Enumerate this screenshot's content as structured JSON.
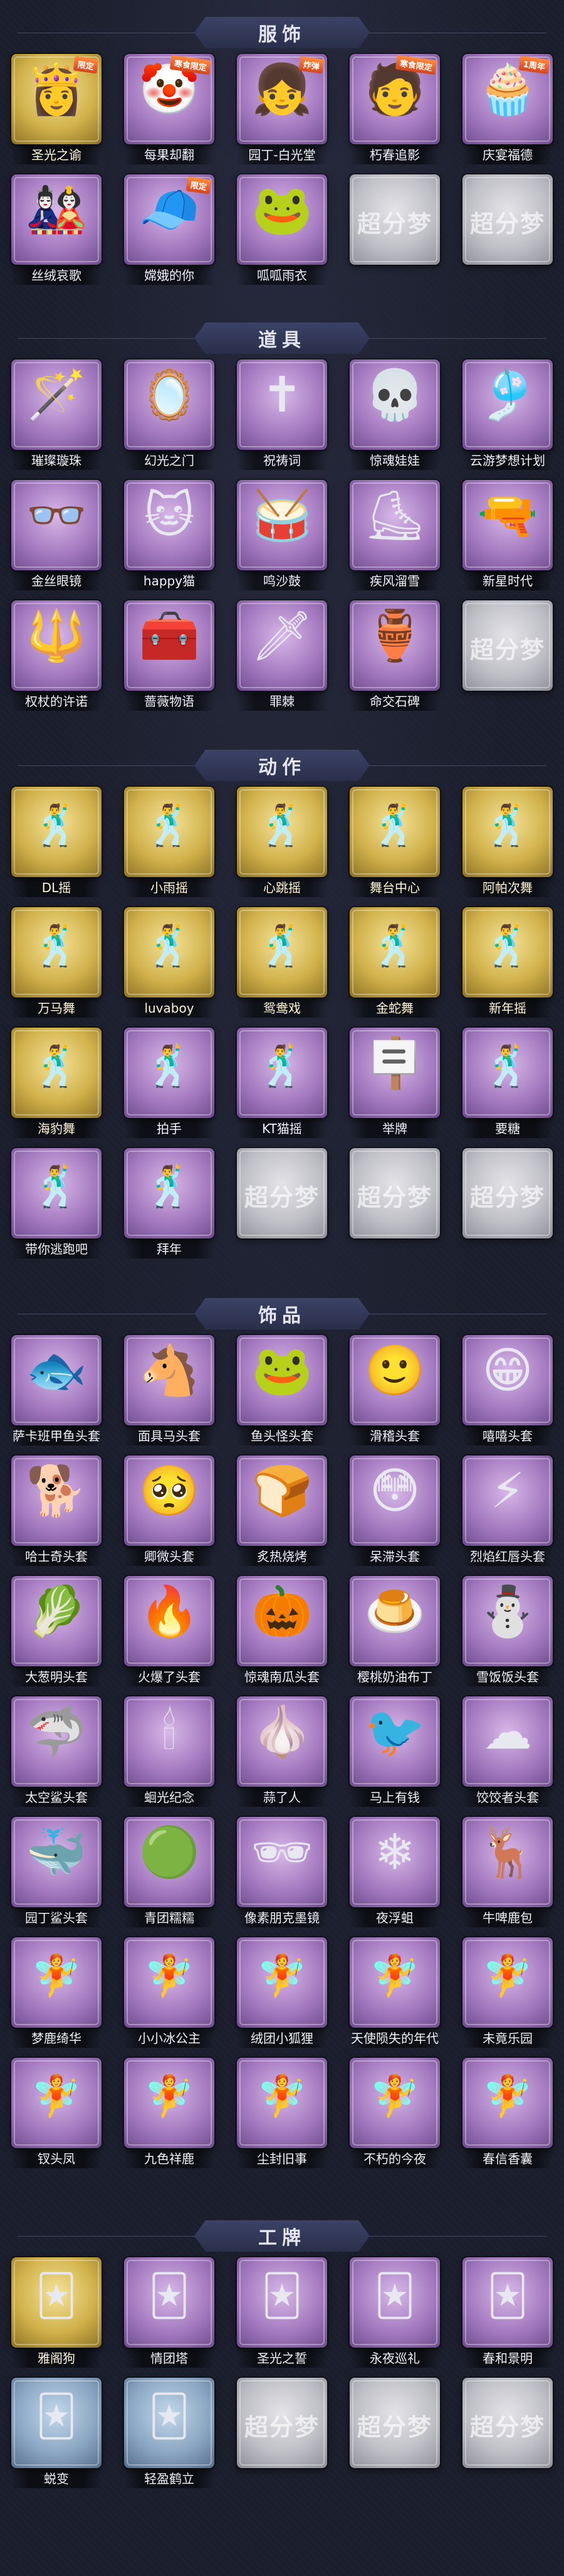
{
  "sections": [
    {
      "title": "服饰",
      "items": [
        {
          "label": "圣光之谕",
          "tier": "gold",
          "icon": "princess",
          "badge": "限定"
        },
        {
          "label": "每果却翻",
          "tier": "purple",
          "icon": "clown",
          "badge": "寒食限定"
        },
        {
          "label": "园丁-白光堂",
          "tier": "purple",
          "icon": "gardener",
          "badge": "炸弹"
        },
        {
          "label": "朽春追影",
          "tier": "purple",
          "icon": "boy",
          "badge": "寒食限定"
        },
        {
          "label": "庆宴福德",
          "tier": "purple",
          "icon": "chef",
          "badge": "1周年"
        },
        {
          "label": "丝绒哀歌",
          "tier": "purple",
          "icon": "doll"
        },
        {
          "label": "嫦娥的你",
          "tier": "purple",
          "icon": "girl-hat",
          "badge": "限定"
        },
        {
          "label": "呱呱雨衣",
          "tier": "purple",
          "icon": "frog-girl"
        },
        {
          "label": "",
          "tier": "grey",
          "placeholder": "超分梦"
        },
        {
          "label": "",
          "tier": "grey",
          "placeholder": "超分梦"
        }
      ]
    },
    {
      "title": "道具",
      "items": [
        {
          "label": "璀璨璇珠",
          "tier": "purple",
          "icon": "wand"
        },
        {
          "label": "幻光之门",
          "tier": "purple",
          "icon": "mirror"
        },
        {
          "label": "祝祷词",
          "tier": "purple",
          "icon": "cross"
        },
        {
          "label": "惊魂娃娃",
          "tier": "purple",
          "icon": "skull"
        },
        {
          "label": "云游梦想计划",
          "tier": "purple",
          "icon": "staff"
        },
        {
          "label": "金丝眼镜",
          "tier": "purple",
          "icon": "glasses"
        },
        {
          "label": "happy猫",
          "tier": "purple",
          "icon": "cat"
        },
        {
          "label": "鸣沙鼓",
          "tier": "purple",
          "icon": "drum"
        },
        {
          "label": "疾风溜雪",
          "tier": "purple",
          "icon": "skates"
        },
        {
          "label": "新星时代",
          "tier": "purple",
          "icon": "gun"
        },
        {
          "label": "权杖的许诺",
          "tier": "purple",
          "icon": "scepter"
        },
        {
          "label": "蔷薇物语",
          "tier": "purple",
          "icon": "firstaid"
        },
        {
          "label": "罪棘",
          "tier": "purple",
          "icon": "sword"
        },
        {
          "label": "命交石碑",
          "tier": "purple",
          "icon": "jar"
        },
        {
          "label": "",
          "tier": "grey",
          "placeholder": "超分梦"
        }
      ]
    },
    {
      "title": "动作",
      "items": [
        {
          "label": "DL摇",
          "tier": "gold",
          "icon": "pose"
        },
        {
          "label": "小雨摇",
          "tier": "gold",
          "icon": "pose"
        },
        {
          "label": "心跳摇",
          "tier": "gold",
          "icon": "pose"
        },
        {
          "label": "舞台中心",
          "tier": "gold",
          "icon": "pose"
        },
        {
          "label": "阿帕次舞",
          "tier": "gold",
          "icon": "pose"
        },
        {
          "label": "万马舞",
          "tier": "gold",
          "icon": "pose"
        },
        {
          "label": "luvaboy",
          "tier": "gold",
          "icon": "pose"
        },
        {
          "label": "鸳鸯戏",
          "tier": "gold",
          "icon": "pose"
        },
        {
          "label": "金蛇舞",
          "tier": "gold",
          "icon": "pose"
        },
        {
          "label": "新年摇",
          "tier": "gold",
          "icon": "pose"
        },
        {
          "label": "海豹舞",
          "tier": "gold",
          "icon": "pose"
        },
        {
          "label": "拍手",
          "tier": "purple",
          "icon": "pose"
        },
        {
          "label": "KT猫摇",
          "tier": "purple",
          "icon": "pose"
        },
        {
          "label": "举牌",
          "tier": "purple",
          "icon": "sign"
        },
        {
          "label": "要糖",
          "tier": "purple",
          "icon": "pose"
        },
        {
          "label": "带你逃跑吧",
          "tier": "purple",
          "icon": "pose"
        },
        {
          "label": "拜年",
          "tier": "purple",
          "icon": "pose"
        },
        {
          "label": "",
          "tier": "grey",
          "placeholder": "超分梦"
        },
        {
          "label": "",
          "tier": "grey",
          "placeholder": "超分梦"
        },
        {
          "label": "",
          "tier": "grey",
          "placeholder": "超分梦"
        }
      ]
    },
    {
      "title": "饰品",
      "items": [
        {
          "label": "萨卡班甲鱼头套",
          "tier": "purple",
          "icon": "fish"
        },
        {
          "label": "面具马头套",
          "tier": "purple",
          "icon": "horse"
        },
        {
          "label": "鱼头怪头套",
          "tier": "purple",
          "icon": "fishman"
        },
        {
          "label": "滑稽头套",
          "tier": "purple",
          "icon": "smile"
        },
        {
          "label": "嘻嘻头套",
          "tier": "purple",
          "icon": "grin"
        },
        {
          "label": "哈士奇头套",
          "tier": "purple",
          "icon": "dog"
        },
        {
          "label": "卿微头套",
          "tier": "purple",
          "icon": "pout"
        },
        {
          "label": "炙热烧烤",
          "tier": "purple",
          "icon": "toast"
        },
        {
          "label": "呆滞头套",
          "tier": "purple",
          "icon": "stare"
        },
        {
          "label": "烈焰红唇头套",
          "tier": "purple",
          "icon": "pikachu"
        },
        {
          "label": "大葱明头套",
          "tier": "purple",
          "icon": "bokchoy"
        },
        {
          "label": "火爆了头套",
          "tier": "purple",
          "icon": "fire"
        },
        {
          "label": "惊魂南瓜头套",
          "tier": "purple",
          "icon": "pumpkin"
        },
        {
          "label": "樱桃奶油布丁",
          "tier": "purple",
          "icon": "pudding"
        },
        {
          "label": "雪饭饭头套",
          "tier": "purple",
          "icon": "snowman"
        },
        {
          "label": "太空鲨头套",
          "tier": "purple",
          "icon": "shark"
        },
        {
          "label": "蛔光纪念",
          "tier": "purple",
          "icon": "candle"
        },
        {
          "label": "蒜了人",
          "tier": "purple",
          "icon": "garlic"
        },
        {
          "label": "马上有钱",
          "tier": "purple",
          "icon": "bird"
        },
        {
          "label": "饺饺者头套",
          "tier": "purple",
          "icon": "cloud"
        },
        {
          "label": "园丁鲨头套",
          "tier": "purple",
          "icon": "bluecat"
        },
        {
          "label": "青团糯糯",
          "tier": "purple",
          "icon": "greenbun"
        },
        {
          "label": "像素朋克墨镜",
          "tier": "purple",
          "icon": "sunglasses"
        },
        {
          "label": "夜浮蛆",
          "tier": "purple",
          "icon": "crystal"
        },
        {
          "label": "牛啤鹿包",
          "tier": "purple",
          "icon": "deer"
        },
        {
          "label": "梦鹿绮华",
          "tier": "purple",
          "icon": "figure"
        },
        {
          "label": "小小冰公主",
          "tier": "purple",
          "icon": "figure"
        },
        {
          "label": "绒团小狐狸",
          "tier": "purple",
          "icon": "figure"
        },
        {
          "label": "天使陨失的年代",
          "tier": "purple",
          "icon": "figure"
        },
        {
          "label": "未竟乐园",
          "tier": "purple",
          "icon": "figure"
        },
        {
          "label": "钗头凤",
          "tier": "purple",
          "icon": "figure"
        },
        {
          "label": "九色祥鹿",
          "tier": "purple",
          "icon": "figure"
        },
        {
          "label": "尘封旧事",
          "tier": "purple",
          "icon": "figure"
        },
        {
          "label": "不朽的今夜",
          "tier": "purple",
          "icon": "figure"
        },
        {
          "label": "春信香囊",
          "tier": "purple",
          "icon": "figure"
        }
      ]
    },
    {
      "title": "工牌",
      "items": [
        {
          "label": "雅阁狗",
          "tier": "gold",
          "icon": "badge"
        },
        {
          "label": "情团塔",
          "tier": "purple",
          "icon": "badge"
        },
        {
          "label": "圣光之誓",
          "tier": "purple",
          "icon": "badge"
        },
        {
          "label": "永夜巡礼",
          "tier": "purple",
          "icon": "badge"
        },
        {
          "label": "春和景明",
          "tier": "purple",
          "icon": "badge"
        },
        {
          "label": "蜕变",
          "tier": "blue",
          "icon": "badge"
        },
        {
          "label": "轻盈鹤立",
          "tier": "blue",
          "icon": "badge"
        },
        {
          "label": "",
          "tier": "grey",
          "placeholder": "超分梦"
        },
        {
          "label": "",
          "tier": "grey",
          "placeholder": "超分梦"
        },
        {
          "label": "",
          "tier": "grey",
          "placeholder": "超分梦"
        }
      ]
    }
  ],
  "icons": {
    "princess": "👸",
    "clown": "🤡",
    "gardener": "👧",
    "boy": "🧑",
    "chef": "🧁",
    "doll": "🎎",
    "girl-hat": "🧢",
    "frog-girl": "🐸",
    "wand": "🪄",
    "mirror": "🪞",
    "cross": "✝",
    "skull": "💀",
    "staff": "🎐",
    "glasses": "👓",
    "cat": "🐱",
    "drum": "🥁",
    "skates": "⛸",
    "gun": "🔫",
    "scepter": "🔱",
    "firstaid": "🧰",
    "sword": "🗡",
    "jar": "🏺",
    "pose": "🕺",
    "sign": "🪧",
    "fish": "🐟",
    "horse": "🐴",
    "fishman": "🐸",
    "smile": "🙂",
    "grin": "😁",
    "dog": "🐕",
    "pout": "🥺",
    "toast": "🍞",
    "stare": "😳",
    "pikachu": "⚡",
    "bokchoy": "🥬",
    "fire": "🔥",
    "pumpkin": "🎃",
    "pudding": "🍮",
    "snowman": "⛄",
    "shark": "🦈",
    "candle": "🕯",
    "garlic": "🧄",
    "bird": "🐦",
    "cloud": "☁",
    "bluecat": "🐳",
    "greenbun": "🟢",
    "sunglasses": "🕶",
    "crystal": "❄",
    "deer": "🦌",
    "figure": "🧚",
    "badge": "🃏"
  }
}
